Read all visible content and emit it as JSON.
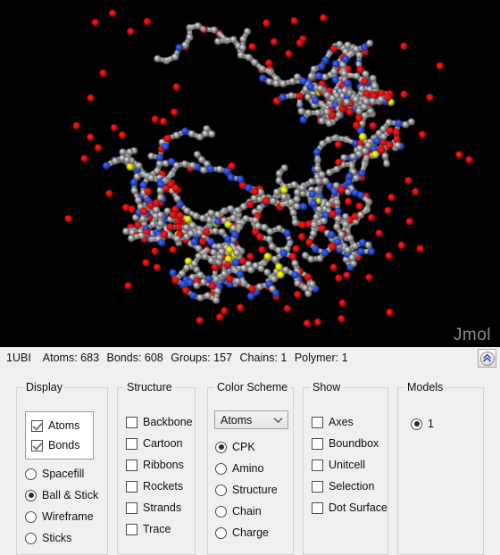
{
  "viewport": {
    "watermark": "Jmol",
    "background_color": "#000000",
    "molecule": {
      "name": "1UBI",
      "representation": "Ball & Stick",
      "color_scheme": "CPK",
      "element_colors": {
        "carbon": "#a0a0a0",
        "nitrogen": "#2b4ce0",
        "oxygen": "#e81010",
        "sulfur": "#e6e600"
      }
    }
  },
  "statusbar": {
    "structure_id": "1UBI",
    "atoms_label": "Atoms: 683",
    "bonds_label": "Bonds: 608",
    "groups_label": "Groups: 157",
    "chains_label": "Chains: 1",
    "polymer_label": "Polymer: 1",
    "collapse_icon": "double-chevron-up-icon"
  },
  "panels": {
    "display": {
      "title": "Display",
      "checkboxes": [
        {
          "label": "Atoms",
          "checked": true
        },
        {
          "label": "Bonds",
          "checked": true
        }
      ],
      "radios": [
        {
          "label": "Spacefill",
          "selected": false
        },
        {
          "label": "Ball & Stick",
          "selected": true
        },
        {
          "label": "Wireframe",
          "selected": false
        },
        {
          "label": "Sticks",
          "selected": false
        }
      ]
    },
    "structure": {
      "title": "Structure",
      "checkboxes": [
        {
          "label": "Backbone",
          "checked": false
        },
        {
          "label": "Cartoon",
          "checked": false
        },
        {
          "label": "Ribbons",
          "checked": false
        },
        {
          "label": "Rockets",
          "checked": false
        },
        {
          "label": "Strands",
          "checked": false
        },
        {
          "label": "Trace",
          "checked": false
        }
      ]
    },
    "color_scheme": {
      "title": "Color Scheme",
      "select_value": "Atoms",
      "select_icon": "chevron-down-icon",
      "radios": [
        {
          "label": "CPK",
          "selected": true
        },
        {
          "label": "Amino",
          "selected": false
        },
        {
          "label": "Structure",
          "selected": false
        },
        {
          "label": "Chain",
          "selected": false
        },
        {
          "label": "Charge",
          "selected": false
        }
      ]
    },
    "show": {
      "title": "Show",
      "checkboxes": [
        {
          "label": "Axes",
          "checked": false
        },
        {
          "label": "Boundbox",
          "checked": false
        },
        {
          "label": "Unitcell",
          "checked": false
        },
        {
          "label": "Selection",
          "checked": false
        },
        {
          "label": "Dot Surface",
          "checked": false
        }
      ]
    },
    "models": {
      "title": "Models",
      "radios": [
        {
          "label": "1",
          "selected": true
        }
      ]
    }
  }
}
